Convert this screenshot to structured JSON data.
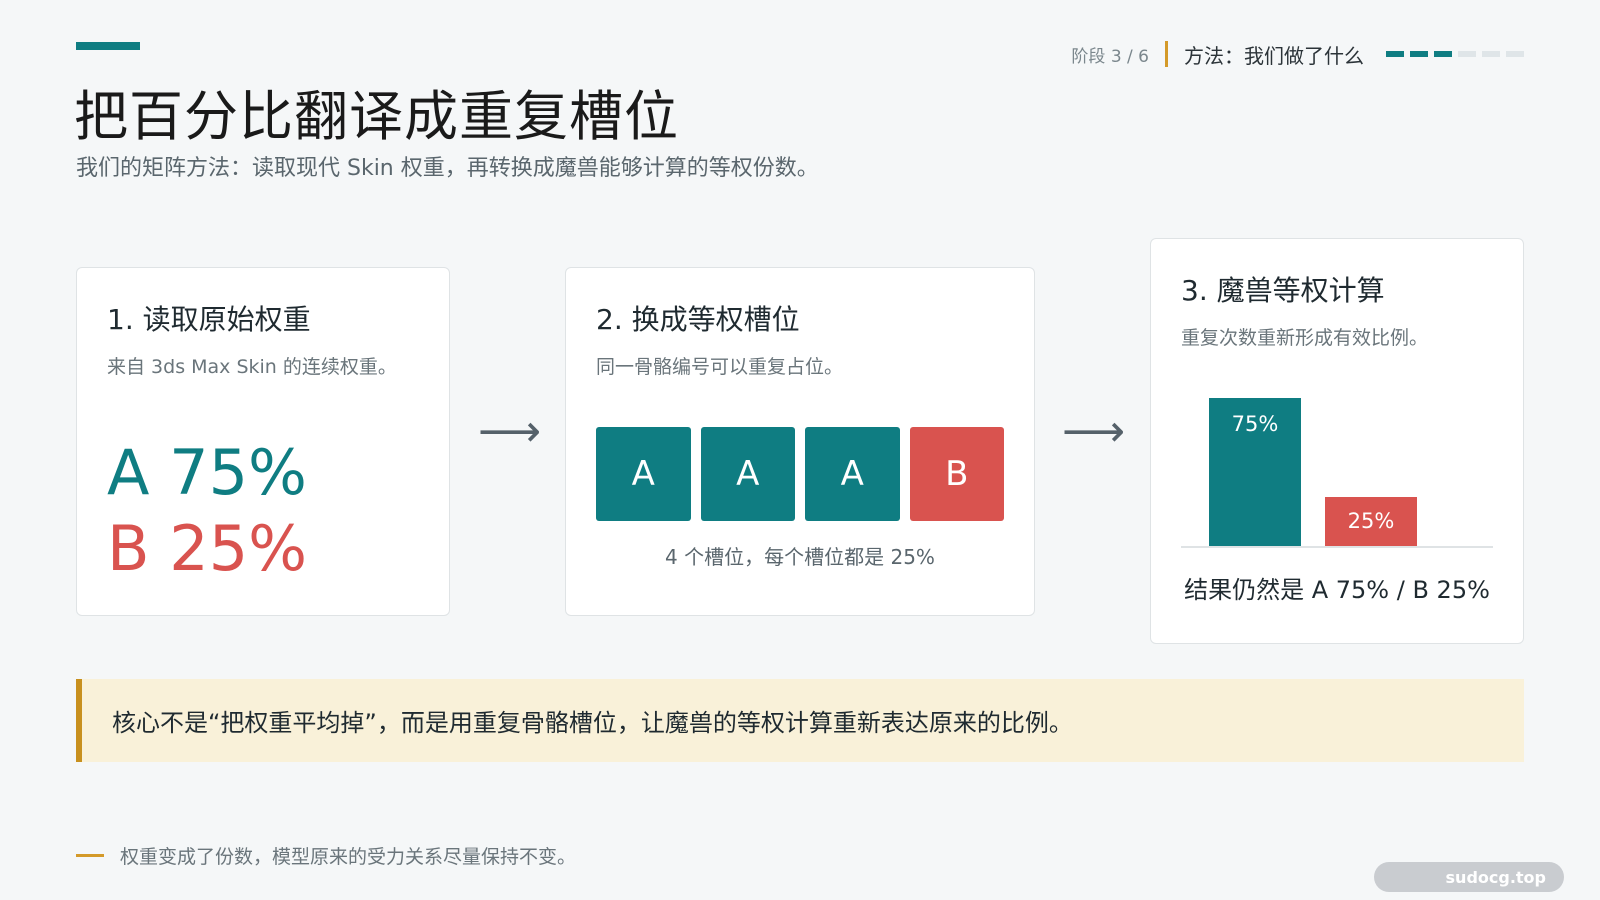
{
  "header": {
    "title": "把百分比翻译成重复槽位",
    "subtitle": "我们的矩阵方法：读取现代 Skin 权重，再转换成魔兽能够计算的等权份数。",
    "stage": "阶段 3 / 6",
    "section": "方法：我们做了什么",
    "progress": {
      "current": 3,
      "total": 6
    }
  },
  "step1": {
    "title": "1. 读取原始权重",
    "desc": "来自 3ds Max Skin 的连续权重。",
    "weight_a": "A 75%",
    "weight_b": "B 25%"
  },
  "arrow_symbol": "⟶",
  "step2": {
    "title": "2. 换成等权槽位",
    "desc": "同一骨骼编号可以重复占位。",
    "slots": [
      "A",
      "A",
      "A",
      "B"
    ],
    "caption": "4 个槽位，每个槽位都是 25%"
  },
  "step3": {
    "title": "3. 魔兽等权计算",
    "desc": "重复次数重新形成有效比例。",
    "bars": [
      {
        "label": "75%",
        "value": 75
      },
      {
        "label": "25%",
        "value": 25
      }
    ],
    "result": "结果仍然是 A 75% / B 25%"
  },
  "callout": "核心不是“把权重平均掉”，而是用重复骨骼槽位，让魔兽的等权计算重新表达原来的比例。",
  "footer": "权重变成了份数，模型原来的受力关系尽量保持不变。",
  "watermark": "sudocg.top",
  "colors": {
    "teal": "#0f7d82",
    "red": "#d9534f",
    "gold": "#c8901e",
    "callout_bg": "#f9f1d9"
  }
}
